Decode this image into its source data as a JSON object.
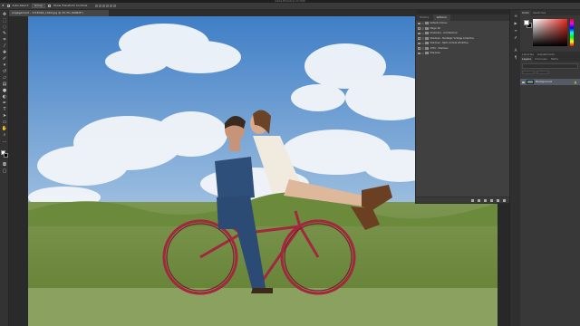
{
  "window": {
    "title": "Adobe Photoshop CC 2018"
  },
  "options_bar": {
    "tool_icon": "move-tool-icon",
    "auto_select_label": "Auto-Select:",
    "auto_select_target": "Group",
    "transform_controls_label": "Show Transform Controls"
  },
  "document": {
    "tab_title": "engagement - 1718394_1920.jpg @ 33.3% (RGB/8*)"
  },
  "toolbar": {
    "tools": [
      "move-tool-icon",
      "artboard-icon",
      "marquee-icon",
      "lasso-icon",
      "quick-select-icon",
      "crop-icon",
      "eyedropper-icon",
      "healing-brush-icon",
      "brush-icon",
      "clone-stamp-icon",
      "history-brush-icon",
      "eraser-icon",
      "gradient-icon",
      "blur-icon",
      "dodge-icon",
      "pen-icon",
      "type-icon",
      "path-select-icon",
      "rectangle-icon",
      "hand-icon",
      "zoom-icon",
      "more-tools-icon"
    ],
    "foreground_color": "#ffffff",
    "background_color": "#000000"
  },
  "actions_panel": {
    "tabs": [
      "History",
      "Actions"
    ],
    "active_tab": "Actions",
    "items": [
      "Default Actions",
      "Magic 4K",
      "Dreamers - Architecture",
      "Shadows - Nostalgic Vintage Collection",
      "Shadows - Retro & Fade Workflow",
      "1970 - Shadows",
      "Shadows"
    ]
  },
  "right_dock": {
    "color_tabs": [
      "Color",
      "Swatches"
    ],
    "active_color_tab": "Color",
    "hue_color": "#e52b21",
    "adjustment_tabs": [
      "Libraries",
      "Adjustments"
    ],
    "layer_tabs": [
      "Layers",
      "Channels",
      "Paths"
    ],
    "active_layer_tab": "Layers",
    "layers": [
      {
        "name": "Background",
        "locked": true
      }
    ]
  },
  "colors": {
    "app_bg": "#282828",
    "panel_bg": "#404040",
    "selected_layer": "#545b66",
    "sky": "#4d87c7",
    "grass": "#6f8b3e",
    "bicycle": "#a3283f"
  }
}
